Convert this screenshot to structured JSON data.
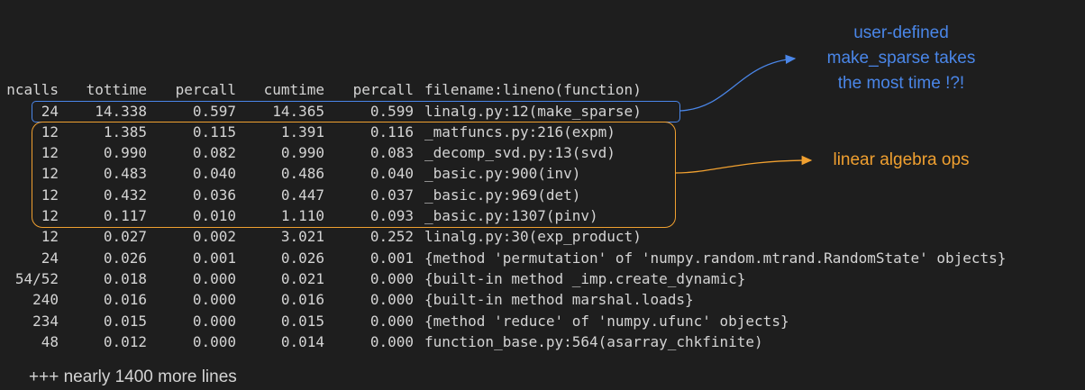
{
  "header": {
    "ncalls": "ncalls",
    "tottime": "tottime",
    "percall": "percall",
    "cumtime": "cumtime",
    "percall2": "percall",
    "filename": "filename:lineno(function)"
  },
  "rows": [
    {
      "ncalls": "24",
      "tottime": "14.338",
      "percall": "0.597",
      "cumtime": "14.365",
      "percall2": "0.599",
      "fn": "linalg.py:12(make_sparse)"
    },
    {
      "ncalls": "12",
      "tottime": "1.385",
      "percall": "0.115",
      "cumtime": "1.391",
      "percall2": "0.116",
      "fn": "_matfuncs.py:216(expm)"
    },
    {
      "ncalls": "12",
      "tottime": "0.990",
      "percall": "0.082",
      "cumtime": "0.990",
      "percall2": "0.083",
      "fn": "_decomp_svd.py:13(svd)"
    },
    {
      "ncalls": "12",
      "tottime": "0.483",
      "percall": "0.040",
      "cumtime": "0.486",
      "percall2": "0.040",
      "fn": "_basic.py:900(inv)"
    },
    {
      "ncalls": "12",
      "tottime": "0.432",
      "percall": "0.036",
      "cumtime": "0.447",
      "percall2": "0.037",
      "fn": "_basic.py:969(det)"
    },
    {
      "ncalls": "12",
      "tottime": "0.117",
      "percall": "0.010",
      "cumtime": "1.110",
      "percall2": "0.093",
      "fn": "_basic.py:1307(pinv)"
    },
    {
      "ncalls": "12",
      "tottime": "0.027",
      "percall": "0.002",
      "cumtime": "3.021",
      "percall2": "0.252",
      "fn": "linalg.py:30(exp_product)"
    },
    {
      "ncalls": "24",
      "tottime": "0.026",
      "percall": "0.001",
      "cumtime": "0.026",
      "percall2": "0.001",
      "fn": "{method 'permutation' of 'numpy.random.mtrand.RandomState' objects}"
    },
    {
      "ncalls": "54/52",
      "tottime": "0.018",
      "percall": "0.000",
      "cumtime": "0.021",
      "percall2": "0.000",
      "fn": "{built-in method _imp.create_dynamic}"
    },
    {
      "ncalls": "240",
      "tottime": "0.016",
      "percall": "0.000",
      "cumtime": "0.016",
      "percall2": "0.000",
      "fn": "{built-in method marshal.loads}"
    },
    {
      "ncalls": "234",
      "tottime": "0.015",
      "percall": "0.000",
      "cumtime": "0.015",
      "percall2": "0.000",
      "fn": "{method 'reduce' of 'numpy.ufunc' objects}"
    },
    {
      "ncalls": "48",
      "tottime": "0.012",
      "percall": "0.000",
      "cumtime": "0.014",
      "percall2": "0.000",
      "fn": "function_base.py:564(asarray_chkfinite)"
    }
  ],
  "annotations": {
    "blue_line1": "user-defined",
    "blue_line2": "make_sparse takes",
    "blue_line3": "the most time !?!",
    "orange": "linear algebra ops",
    "blue_color": "#4a86e8",
    "orange_color": "#f0a030"
  },
  "footer": "+++ nearly 1400 more lines"
}
